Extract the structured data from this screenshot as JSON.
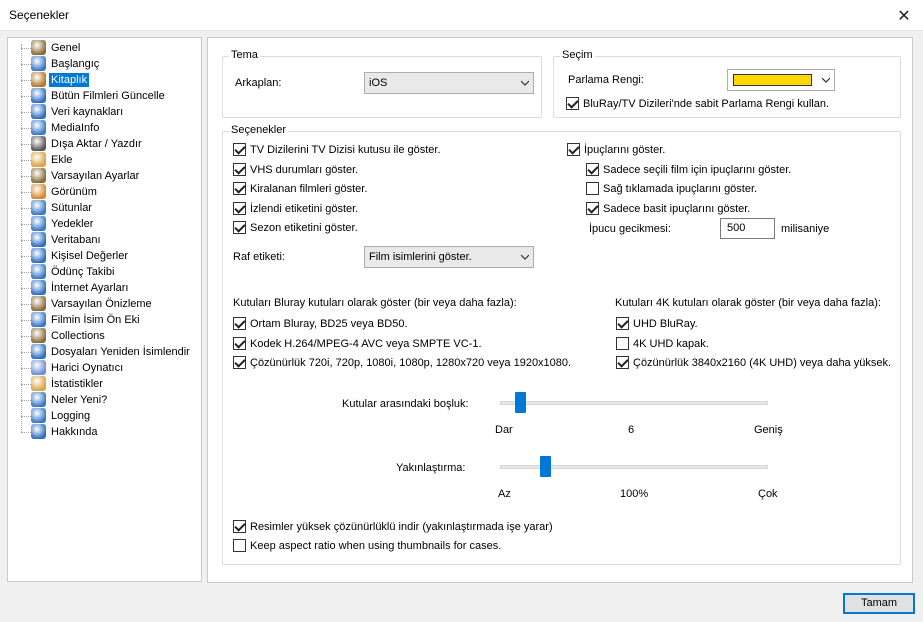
{
  "window": {
    "title": "Seçenekler"
  },
  "tree": [
    {
      "label": "Genel",
      "icon": "wrench-icon",
      "color": "#8a6d3b"
    },
    {
      "label": "Başlangıç",
      "icon": "monitor-icon",
      "color": "#3a78c8"
    },
    {
      "label": "Kitaplık",
      "icon": "books-icon",
      "color": "#b07a2c",
      "selected": true
    },
    {
      "label": "Bütün Filmleri Güncelle",
      "icon": "globe-icon",
      "color": "#2f6fc4"
    },
    {
      "label": "Veri kaynakları",
      "icon": "globe-icon",
      "color": "#2f6fc4"
    },
    {
      "label": "MediaInfo",
      "icon": "monitor-icon",
      "color": "#3a78c8"
    },
    {
      "label": "Dışa Aktar / Yazdır",
      "icon": "printer-icon",
      "color": "#555555"
    },
    {
      "label": "Ekle",
      "icon": "document-icon",
      "color": "#d9a441"
    },
    {
      "label": "Varsayılan Ayarlar",
      "icon": "wrench-icon",
      "color": "#8a6d3b"
    },
    {
      "label": "Görünüm",
      "icon": "palette-icon",
      "color": "#d48a2c"
    },
    {
      "label": "Sütunlar",
      "icon": "monitor-icon",
      "color": "#3a78c8"
    },
    {
      "label": "Yedekler",
      "icon": "monitor-icon",
      "color": "#3a78c8"
    },
    {
      "label": "Veritabanı",
      "icon": "globe-icon",
      "color": "#2f6fc4"
    },
    {
      "label": "Kişisel Değerler",
      "icon": "globe-icon",
      "color": "#2f6fc4"
    },
    {
      "label": "Ödünç Takibi",
      "icon": "monitor-icon",
      "color": "#3a78c8"
    },
    {
      "label": "İnternet Ayarları",
      "icon": "globe-icon",
      "color": "#2f6fc4"
    },
    {
      "label": "Varsayılan Önizleme",
      "icon": "wrench-icon",
      "color": "#8a6d3b"
    },
    {
      "label": "Filmin İsim Ön Eki",
      "icon": "monitor-icon",
      "color": "#3a78c8"
    },
    {
      "label": "Collections",
      "icon": "wrench-icon",
      "color": "#8a6d3b"
    },
    {
      "label": "Dosyaları Yeniden İsimlendir",
      "icon": "globe-icon",
      "color": "#2f6fc4"
    },
    {
      "label": "Harici Oynatıcı",
      "icon": "globe-icon",
      "color": "#6b8fd6"
    },
    {
      "label": "İstatistikler",
      "icon": "chart-icon",
      "color": "#d9a441"
    },
    {
      "label": "Neler Yeni?",
      "icon": "monitor-icon",
      "color": "#3a78c8"
    },
    {
      "label": "Logging",
      "icon": "monitor-icon",
      "color": "#3a78c8"
    },
    {
      "label": "Hakkında",
      "icon": "info-icon",
      "color": "#2f6fc4"
    }
  ],
  "tema": {
    "title": "Tema",
    "background_label": "Arkaplan:",
    "background_value": "iOS"
  },
  "secim": {
    "title": "Seçim",
    "highlight_label": "Parlama Rengi:",
    "highlight_color": "#ffd700",
    "fixed_highlight_label": "BluRay/TV Dizileri'nde sabit Parlama Rengi kullan.",
    "fixed_highlight_checked": true
  },
  "secenekler": {
    "title": "Seçenekler",
    "left_checks": [
      {
        "label": "TV Dizilerini TV Dizisi kutusu ile göster.",
        "checked": true
      },
      {
        "label": "VHS durumları göster.",
        "checked": true
      },
      {
        "label": "Kiralanan filmleri göster.",
        "checked": true
      },
      {
        "label": "İzlendi etiketini göster.",
        "checked": true
      },
      {
        "label": "Sezon etiketini göster.",
        "checked": true
      }
    ],
    "right_checks": [
      {
        "label": "İpuçlarını göster.",
        "checked": true
      },
      {
        "label": "Sadece seçili film için ipuçlarını göster.",
        "checked": true
      },
      {
        "label": "Sağ tıklamada ipuçlarını göster.",
        "checked": false
      },
      {
        "label": "Sadece basit ipuçlarını göster.",
        "checked": true
      }
    ],
    "tooltip_delay_label": "İpucu gecikmesi:",
    "tooltip_delay_value": "500",
    "tooltip_delay_unit": "milisaniye",
    "shelf_label": "Raf etiketi:",
    "shelf_value": "Film isimlerini göster.",
    "bluray_title": "Kutuları Bluray kutuları olarak göster (bir veya daha fazla):",
    "bluray_checks": [
      {
        "label": "Ortam Bluray, BD25 veya BD50.",
        "checked": true
      },
      {
        "label": "Kodek H.264/MPEG-4 AVC veya SMPTE VC-1.",
        "checked": true
      },
      {
        "label": "Çözünürlük 720i, 720p, 1080i, 1080p, 1280x720 veya 1920x1080.",
        "checked": true
      }
    ],
    "k4_title": "Kutuları 4K kutuları olarak göster (bir veya daha fazla):",
    "k4_checks": [
      {
        "label": "UHD BluRay.",
        "checked": true
      },
      {
        "label": "4K UHD kapak.",
        "checked": false
      },
      {
        "label": "Çözünürlük 3840x2160 (4K UHD) veya daha yüksek.",
        "checked": true
      }
    ],
    "spacing": {
      "label": "Kutular arasındaki boşluk:",
      "min_label": "Dar",
      "value_label": "6",
      "max_label": "Geniş",
      "fraction": 0.06
    },
    "zoom": {
      "label": "Yakınlaştırma:",
      "min_label": "Az",
      "value_label": "100%",
      "max_label": "Çok",
      "fraction": 0.155
    },
    "bottom_checks": [
      {
        "label": "Resimler yüksek çözünürlüklü indir (yakınlaştırmada işe yarar)",
        "checked": true
      },
      {
        "label": "Keep aspect ratio when using thumbnails for cases.",
        "checked": false
      }
    ]
  },
  "footer": {
    "ok_label": "Tamam"
  }
}
